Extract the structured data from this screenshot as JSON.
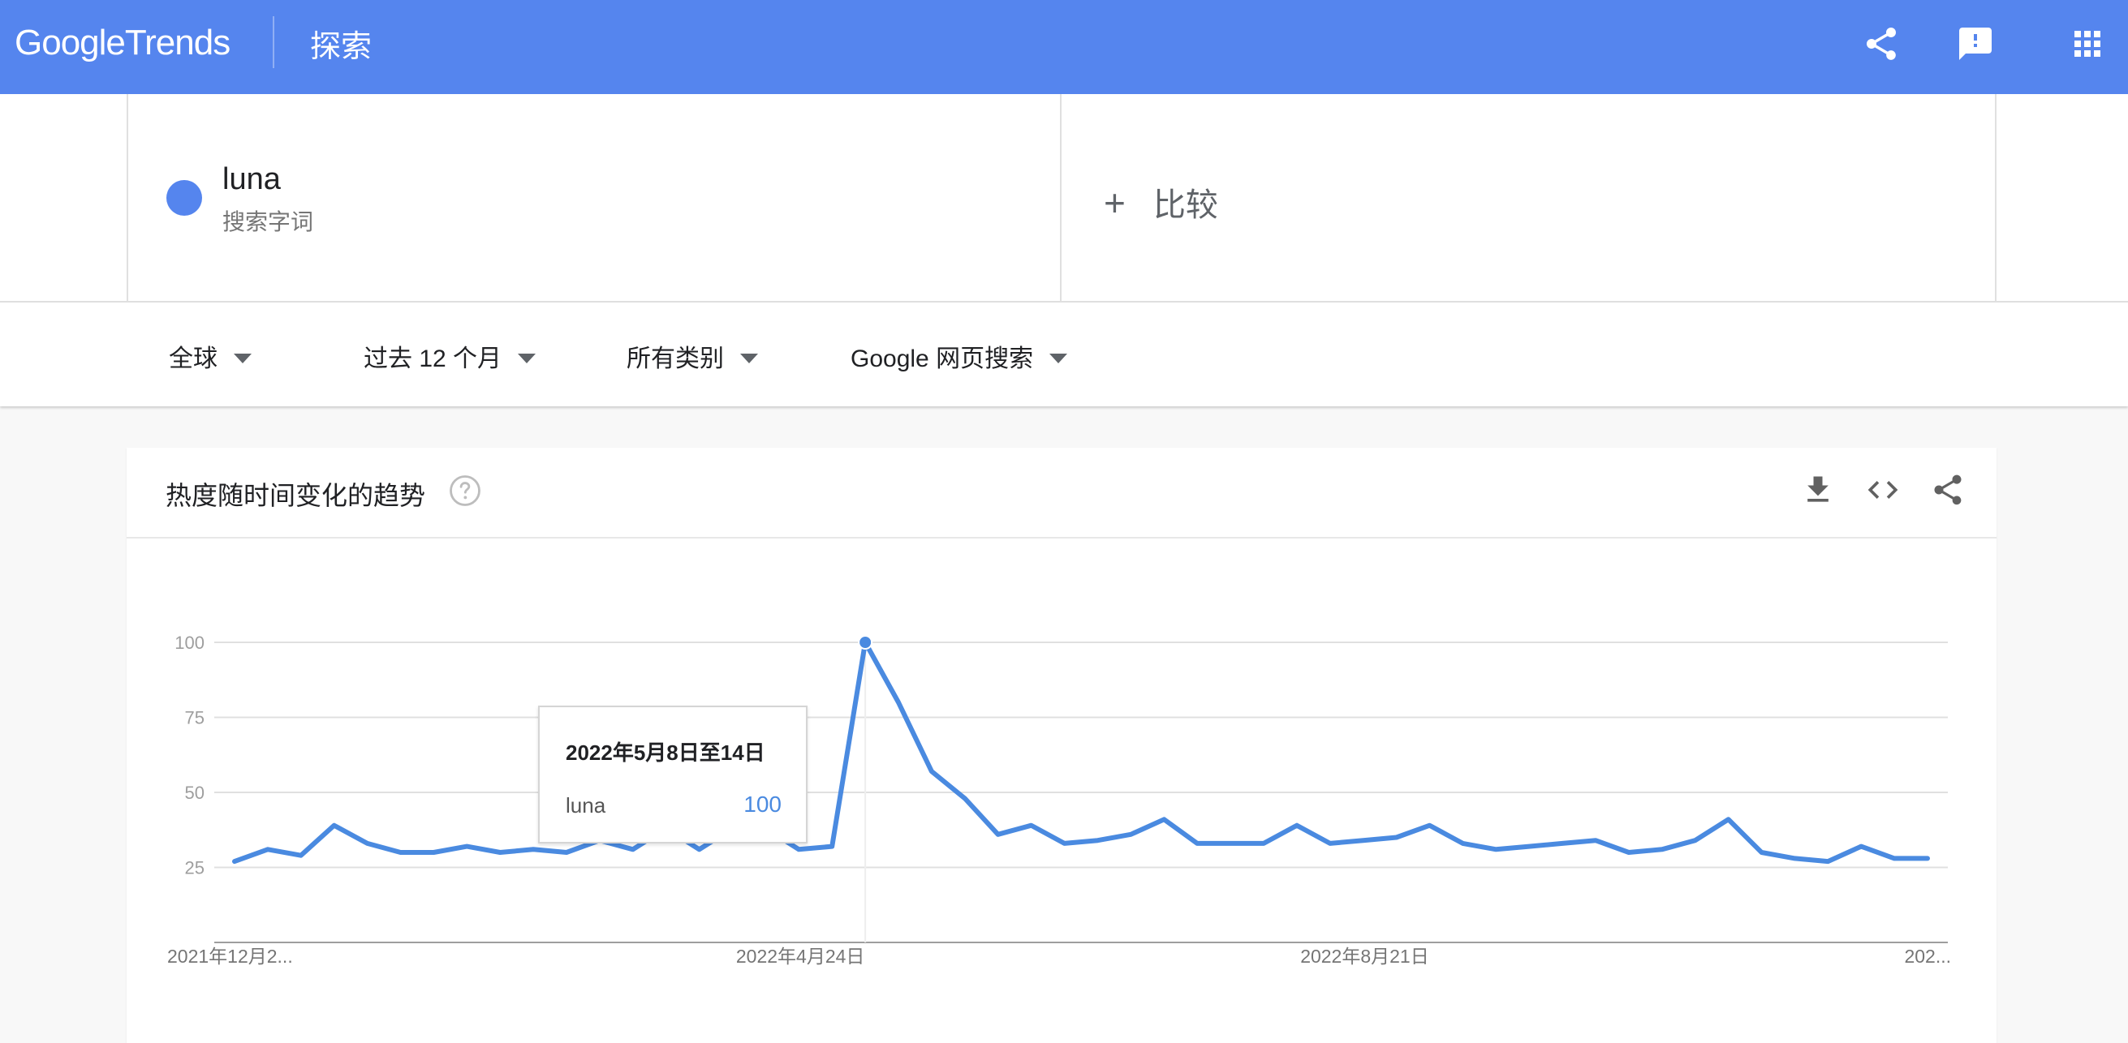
{
  "header": {
    "logo_google": "Google",
    "logo_trends": "Trends",
    "title": "探索",
    "icons": [
      "share-icon",
      "feedback-icon",
      "apps-icon"
    ]
  },
  "term": {
    "name": "luna",
    "type": "搜索字词",
    "color": "#5585ee",
    "compare_label": "比较"
  },
  "filters": {
    "region": "全球",
    "time": "过去 12 个月",
    "category": "所有类别",
    "search_type": "Google 网页搜索"
  },
  "card": {
    "title": "热度随时间变化的趋势",
    "icons": [
      "download-icon",
      "embed-icon",
      "share-icon",
      "help-icon"
    ]
  },
  "tooltip": {
    "date": "2022年5月8日至14日",
    "series": "luna",
    "value": "100"
  },
  "chart_data": {
    "type": "line",
    "x_tick_labels": [
      "2021年12月2...",
      "2022年4月24日",
      "2022年8月21日",
      "202..."
    ],
    "x_tick_indices": [
      0,
      19,
      36,
      51
    ],
    "yticks": [
      25,
      50,
      75,
      100
    ],
    "ylim": [
      0,
      100
    ],
    "grid": true,
    "series": [
      {
        "name": "luna",
        "color": "#4a8ae0",
        "values": [
          27,
          31,
          29,
          39,
          33,
          30,
          30,
          32,
          30,
          31,
          30,
          34,
          31,
          38,
          31,
          38,
          38,
          31,
          32,
          100,
          80,
          57,
          48,
          36,
          39,
          33,
          34,
          36,
          41,
          33,
          33,
          33,
          39,
          33,
          34,
          35,
          39,
          33,
          31,
          32,
          33,
          34,
          30,
          31,
          34,
          41,
          30,
          28,
          27,
          32,
          28,
          28
        ]
      }
    ],
    "highlight_index": 19
  }
}
